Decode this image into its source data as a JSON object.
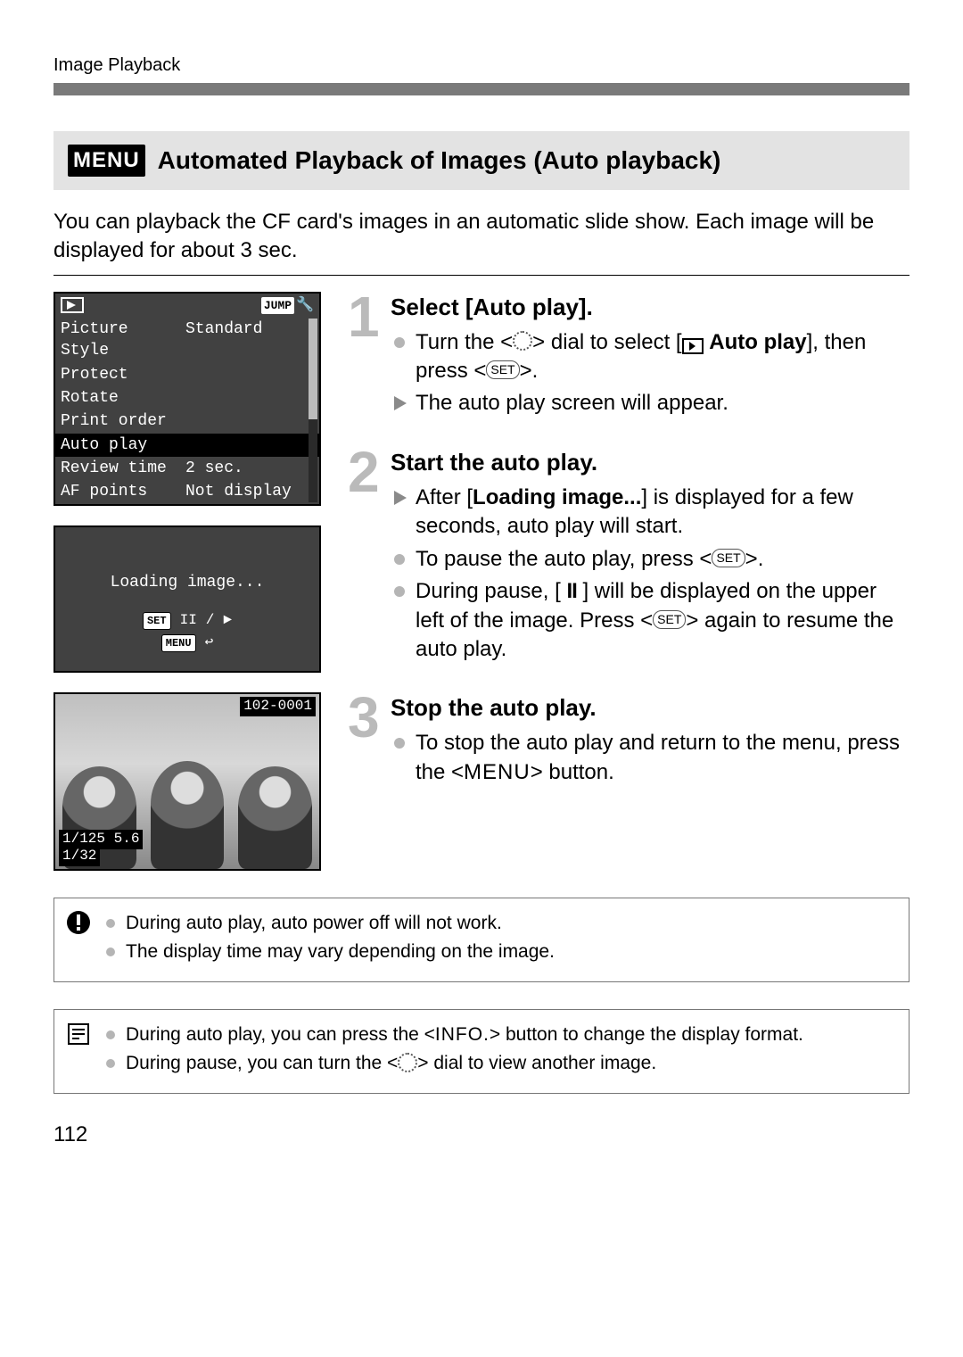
{
  "running_head": "Image Playback",
  "section": {
    "menu_badge": "MENU",
    "title": "Automated Playback of Images (Auto playback)"
  },
  "intro": "You can playback the CF card's images in an automatic slide show. Each image will be displayed for about 3 sec.",
  "screen_menu": {
    "jump_badge": "JUMP",
    "rows": [
      {
        "label": "Picture Style",
        "value": "Standard",
        "selected": false
      },
      {
        "label": "Protect",
        "value": "",
        "selected": false
      },
      {
        "label": "Rotate",
        "value": "",
        "selected": false
      },
      {
        "label": "Print order",
        "value": "",
        "selected": false
      },
      {
        "label": "Auto play",
        "value": "",
        "selected": true
      },
      {
        "label": "Review time",
        "value": "2 sec.",
        "selected": false
      },
      {
        "label": "AF points",
        "value": "Not display",
        "selected": false
      }
    ]
  },
  "screen_loading": {
    "text": "Loading image...",
    "set_badge": "SET",
    "menu_badge": "MENU"
  },
  "screen_photo": {
    "file_no": "102-0001",
    "exposure": "1/125  5.6",
    "count": "1/32"
  },
  "steps": [
    {
      "num": "1",
      "head": "Select [Auto play].",
      "lines": [
        {
          "type": "dot",
          "html": "Turn the <<span class='dial-icon'></span>> dial to select [<span class='play-inline'></span> <b>Auto play</b>], then press <<span class='set-pill'>SET</span>>."
        },
        {
          "type": "tri",
          "html": "The auto play screen will appear."
        }
      ]
    },
    {
      "num": "2",
      "head": "Start the auto play.",
      "lines": [
        {
          "type": "tri",
          "html": "After [<b>Loading image...</b>] is displayed for a few seconds, auto play will start."
        },
        {
          "type": "dot",
          "html": "To pause the auto play, press <<span class='set-pill'>SET</span>>."
        },
        {
          "type": "dot",
          "html": "During pause, [ <span class='pause-inline'>II</span> ] will be displayed on the upper left of the image. Press <<span class='set-pill'>SET</span>> again to resume the auto play."
        }
      ]
    },
    {
      "num": "3",
      "head": "Stop the auto play.",
      "lines": [
        {
          "type": "dot",
          "html": "To stop the auto play and return to the menu, press the <<span class='menu-word'>MENU</span>> button."
        }
      ]
    }
  ],
  "note_warning": [
    "During auto play, auto power off will not work.",
    "The display time may vary depending on the image."
  ],
  "note_info": [
    {
      "html": "During auto play, you can press the <<span class='info-word'>INFO.</span>> button to change the display format."
    },
    {
      "html": "During pause, you can turn the <<span class='dial-icon'></span>> dial to view another image."
    }
  ],
  "page_number": "112"
}
